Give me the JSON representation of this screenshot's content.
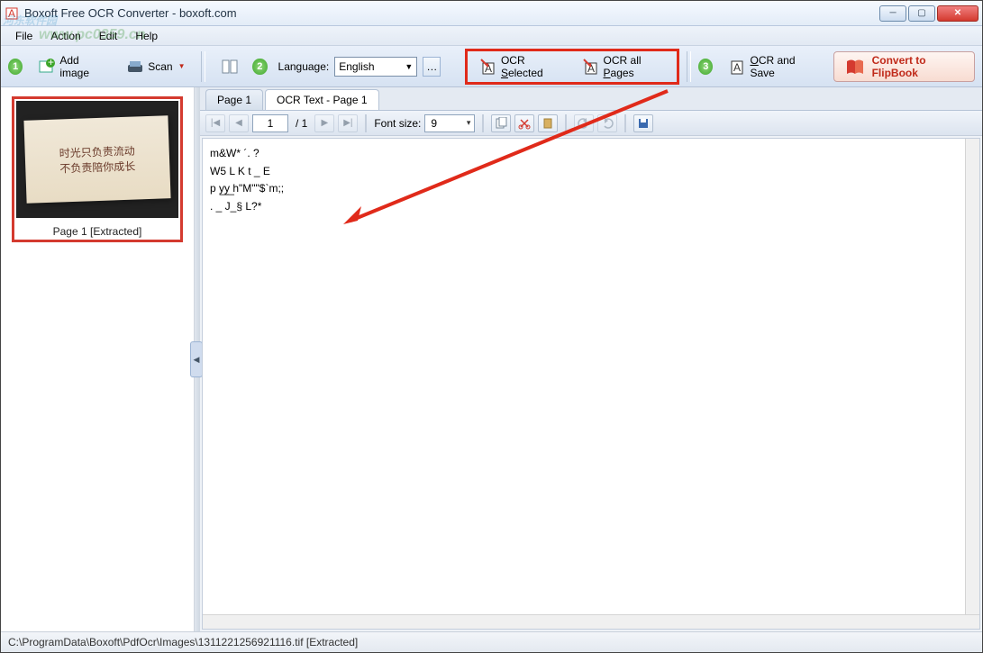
{
  "window": {
    "title": "Boxoft Free OCR Converter - boxoft.com"
  },
  "watermark": {
    "main": "河东软件园",
    "sub": "www.pc0359.cn"
  },
  "menu": {
    "file": "File",
    "action": "Action",
    "edit": "Edit",
    "help": "Help"
  },
  "toolbar": {
    "step1": "1",
    "add_image": "Add image",
    "scan": "Scan",
    "step2": "2",
    "language_label": "Language:",
    "language_value": "English",
    "ocr_selected": "OCR Selected",
    "ocr_all_pages": "OCR all Pages",
    "step3": "3",
    "ocr_and_save": "OCR and Save",
    "convert_flipbook": "Convert to FlipBook"
  },
  "sidebar": {
    "thumb1_line1": "时光只负责流动",
    "thumb1_line2": "不负责陪你成长",
    "thumb1_label": "Page 1 [Extracted]"
  },
  "tabs": {
    "page1": "Page 1",
    "ocr_text": "OCR Text - Page 1"
  },
  "pager": {
    "current": "1",
    "total": "/  1",
    "font_label": "Font size:",
    "font_value": "9"
  },
  "ocr_text": "m&W* ´. ?\nW5 L K t _ E\np y͟y͟ h\"M\"\"$`m;;\n. _ J_§ L?*",
  "statusbar": {
    "path": "C:\\ProgramData\\Boxoft\\PdfOcr\\Images\\1311221256921116.tif [Extracted]"
  }
}
